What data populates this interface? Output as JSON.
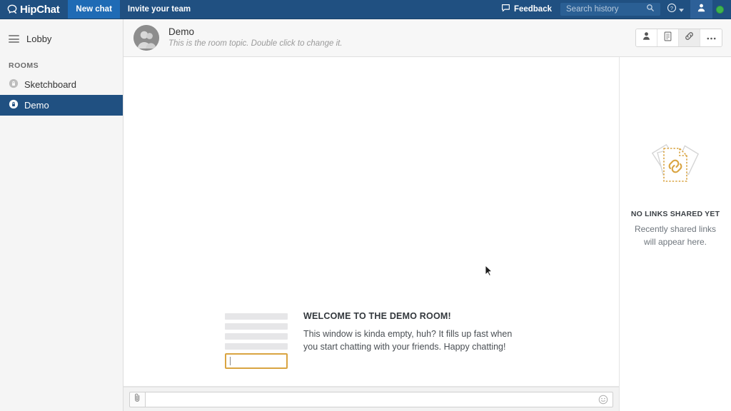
{
  "topbar": {
    "brand": "HipChat",
    "brand_icon": "speech-bubble-icon",
    "new_chat_label": "New chat",
    "invite_label": "Invite your team",
    "feedback_label": "Feedback",
    "feedback_icon": "speech-bubble-icon",
    "search_placeholder": "Search history",
    "search_value": "",
    "search_icon": "search-icon",
    "help_icon": "question-circle-icon",
    "help_caret_icon": "chevron-down-icon",
    "avatar_icon": "person-icon",
    "status_icon": "status-dot-icon",
    "colors": {
      "background": "#205081",
      "active": "#1f6bb5",
      "status_green": "#3fb34f"
    }
  },
  "sidebar": {
    "lobby_label": "Lobby",
    "lobby_icon": "hamburger-icon",
    "section_label": "ROOMS",
    "rooms": [
      {
        "label": "Sketchboard",
        "icon": "lock-circle-icon",
        "selected": false
      },
      {
        "label": "Demo",
        "icon": "lock-circle-icon",
        "selected": true
      }
    ]
  },
  "room_header": {
    "avatar_icon": "person-avatar-icon",
    "name": "Demo",
    "topic": "This is the room topic. Double click to change it.",
    "actions": [
      {
        "name": "people-button",
        "icon": "person-icon",
        "active": false
      },
      {
        "name": "files-button",
        "icon": "document-icon",
        "active": false
      },
      {
        "name": "links-button",
        "icon": "link-icon",
        "active": true
      },
      {
        "name": "more-button",
        "icon": "ellipsis-icon",
        "active": false
      }
    ]
  },
  "welcome": {
    "title": "WELCOME TO THE DEMO ROOM!",
    "body": "This window is kinda empty, huh? It fills up fast when you start chatting with your friends. Happy chatting!",
    "illustration_icon": "chat-placeholder-illustration"
  },
  "composer": {
    "attach_icon": "paperclip-icon",
    "message_value": "",
    "message_placeholder": "",
    "emoji_icon": "smiley-icon"
  },
  "right_panel": {
    "illustration_icon": "link-cards-illustration",
    "empty_title": "NO LINKS SHARED YET",
    "empty_subtitle": "Recently shared links will appear here.",
    "accent_color": "#d9a441"
  }
}
